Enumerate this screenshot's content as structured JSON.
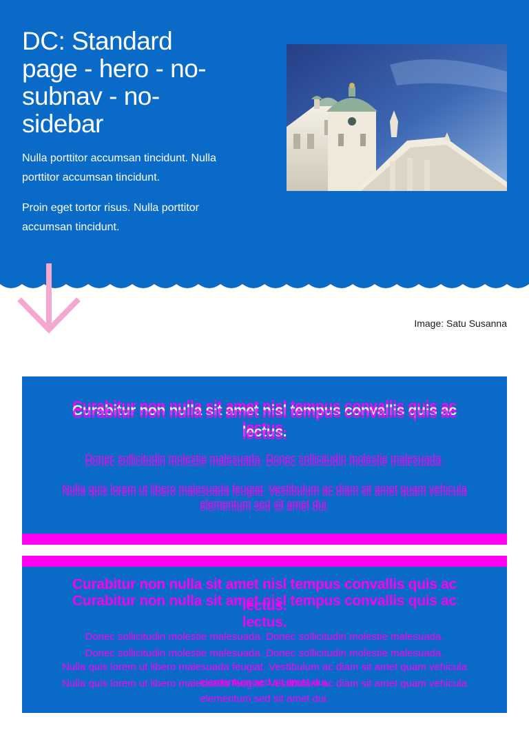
{
  "hero": {
    "title": "DC: Standard page - hero - no-subnav - no-sidebar",
    "paragraphs": [
      "Nulla porttitor accumsan tincidunt. Nulla porttitor accumsan tincidunt.",
      "Proin eget tortor risus. Nulla porttitor accumsan tincidunt."
    ],
    "image_caption": "Image: Satu Susanna",
    "image_icon": "cathedral-photo",
    "arrow_icon": "arrow-down-icon"
  },
  "blocks": [
    {
      "title": "Curabitur non nulla sit amet nisl tempus convallis quis ac lectus.",
      "text1": "Donec sollicitudin molestie malesuada. Donec sollicitudin molestie malesuada.",
      "text2": "Nulla quis lorem ut libero malesuada feugiat. Vestibulum ac diam sit amet quam vehicula elementum sed sit amet dui."
    },
    {
      "title": "Curabitur non nulla sit amet nisl tempus convallis quis ac lectus.",
      "text1": "Donec sollicitudin molestie malesuada. Donec sollicitudin molestie malesuada.",
      "text2": "Nulla quis lorem ut libero malesuada feugiat. Vestibulum ac diam sit amet quam vehicula elementum sed sit amet dui."
    }
  ],
  "colors": {
    "hero_bg": "#0a6ac7",
    "accent_magenta": "#ff00f0",
    "arrow_pink": "#f4a7cf"
  }
}
